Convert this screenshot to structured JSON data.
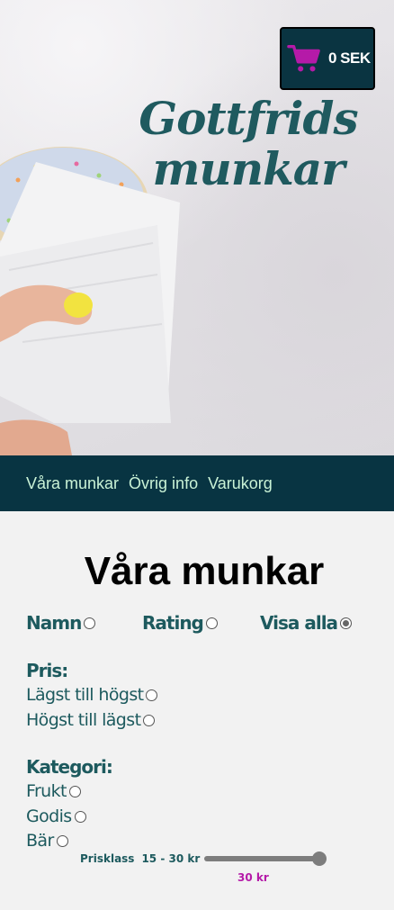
{
  "hero": {
    "brand_title": "Gottfrids munkar",
    "cart": {
      "icon": "shopping-cart-icon",
      "icon_color": "#b51aa8",
      "total": "0 SEK"
    }
  },
  "nav": {
    "items": [
      {
        "label": "Våra munkar"
      },
      {
        "label": "Övrig info"
      },
      {
        "label": "Varukorg"
      }
    ],
    "background": "#083442",
    "link_color": "#c9f2d6"
  },
  "main": {
    "title": "Våra munkar",
    "sort": {
      "options": [
        {
          "label": "Namn",
          "checked": false
        },
        {
          "label": "Rating",
          "checked": false
        },
        {
          "label": "Visa alla",
          "checked": true
        }
      ]
    },
    "price_sort": {
      "title": "Pris:",
      "options": [
        {
          "label": "Lägst till högst",
          "checked": false
        },
        {
          "label": "Högst till lägst",
          "checked": false
        }
      ]
    },
    "category": {
      "title": "Kategori:",
      "options": [
        {
          "label": "Frukt",
          "checked": false
        },
        {
          "label": "Godis",
          "checked": false
        },
        {
          "label": "Bär",
          "checked": false
        }
      ]
    },
    "price_filter": {
      "label": "Prisklass",
      "range": "15 - 30 kr",
      "min": 15,
      "max": 30,
      "value": 30,
      "value_label": "30 kr",
      "value_color": "#b51aa8"
    }
  }
}
